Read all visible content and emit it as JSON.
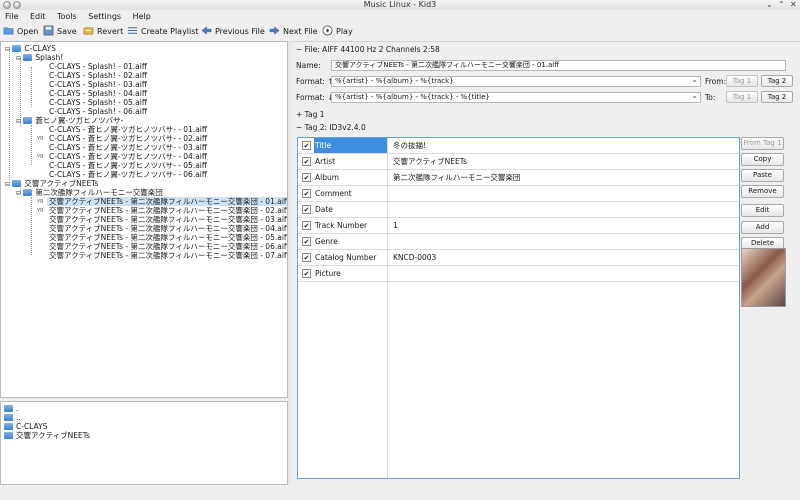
{
  "window": {
    "title": "Music Linux - Kid3"
  },
  "menu": [
    "File",
    "Edit",
    "Tools",
    "Settings",
    "Help"
  ],
  "toolbar": {
    "open": "Open",
    "save": "Save",
    "revert": "Revert",
    "create_playlist": "Create Playlist",
    "previous_file": "Previous File",
    "next_file": "Next File",
    "play": "Play"
  },
  "file_tree": {
    "root": "C-CLAYS",
    "albums": [
      {
        "name": "Splash!",
        "files": [
          "C-CLAYS - Splash! - 01.aiff",
          "C-CLAYS - Splash! - 02.aiff",
          "C-CLAYS - Splash! - 03.aiff",
          "C-CLAYS - Splash! - 04.aiff",
          "C-CLAYS - Splash! - 05.aiff",
          "C-CLAYS - Splash! - 06.aiff"
        ]
      },
      {
        "name": "蒼ヒノ翼-ツガヒノツバサ-",
        "files": [
          "C-CLAYS - 蒼ヒノ翼-ツガヒノツバサ- - 01.aiff",
          "C-CLAYS - 蒼ヒノ翼-ツガヒノツバサ- - 02.aiff",
          "C-CLAYS - 蒼ヒノ翼-ツガヒノツバサ- - 03.aiff",
          "C-CLAYS - 蒼ヒノ翼-ツガヒノツバサ- - 04.aiff",
          "C-CLAYS - 蒼ヒノ翼-ツガヒノツバサ- - 05.aiff",
          "C-CLAYS - 蒼ヒノ翼-ツガヒノツバサ- - 06.aiff"
        ]
      }
    ],
    "root2": "交響アクティブNEETs",
    "album2": {
      "name": "第二次艦隊フィルハーモニー交響楽団",
      "files": [
        "交響アクティブNEETs - 第二次艦隊フィルハーモニー交響楽団 - 01.aiff",
        "交響アクティブNEETs - 第二次艦隊フィルハーモニー交響楽団 - 02.aiff",
        "交響アクティブNEETs - 第二次艦隊フィルハーモニー交響楽団 - 03.aiff",
        "交響アクティブNEETs - 第二次艦隊フィルハーモニー交響楽団 - 04.aiff",
        "交響アクティブNEETs - 第二次艦隊フィルハーモニー交響楽団 - 05.aiff",
        "交響アクティブNEETs - 第二次艦隊フィルハーモニー交響楽団 - 06.aiff",
        "交響アクティブNEETs - 第二次艦隊フィルハーモニー交響楽団 - 07.aiff"
      ]
    }
  },
  "dir_list": [
    ".",
    "..",
    "C-CLAYS",
    "交響アクティブNEETs"
  ],
  "file_info": "File: AIFF 44100 Hz 2 Channels 2:58",
  "name": {
    "label": "Name:",
    "value": "交響アクティブNEETs - 第二次艦隊フィルハーモニー交響楽団 - 01.aiff"
  },
  "format_up": {
    "label": "Format: ↑",
    "value": "%{artist} - %{album} - %{track}",
    "from": "From:",
    "tag1": "Tag 1",
    "tag2": "Tag 2"
  },
  "format_down": {
    "label": "Format: ↓",
    "value": "%{artist} - %{album} - %{track} - %{title}",
    "to": "To:",
    "tag1": "Tag 1",
    "tag2": "Tag 2"
  },
  "tag1_header": "Tag 1",
  "tag2_header": "Tag 2: ID3v2.4.0",
  "tag_fields": [
    {
      "name": "Title",
      "value": "冬の抜錨!"
    },
    {
      "name": "Artist",
      "value": "交響アクティブNEETs"
    },
    {
      "name": "Album",
      "value": "第二次艦隊フィルハーモニー交響楽団"
    },
    {
      "name": "Comment",
      "value": ""
    },
    {
      "name": "Date",
      "value": ""
    },
    {
      "name": "Track Number",
      "value": "1"
    },
    {
      "name": "Genre",
      "value": ""
    },
    {
      "name": "Catalog Number",
      "value": "KNCD-0003"
    },
    {
      "name": "Picture",
      "value": ""
    }
  ],
  "side_buttons": {
    "from_tag1": "From Tag 1",
    "copy": "Copy",
    "paste": "Paste",
    "remove": "Remove",
    "edit": "Edit",
    "add": "Add",
    "delete": "Delete"
  },
  "colors": {
    "selection": "#3d8ee0",
    "folder": "#4a8fd8"
  }
}
